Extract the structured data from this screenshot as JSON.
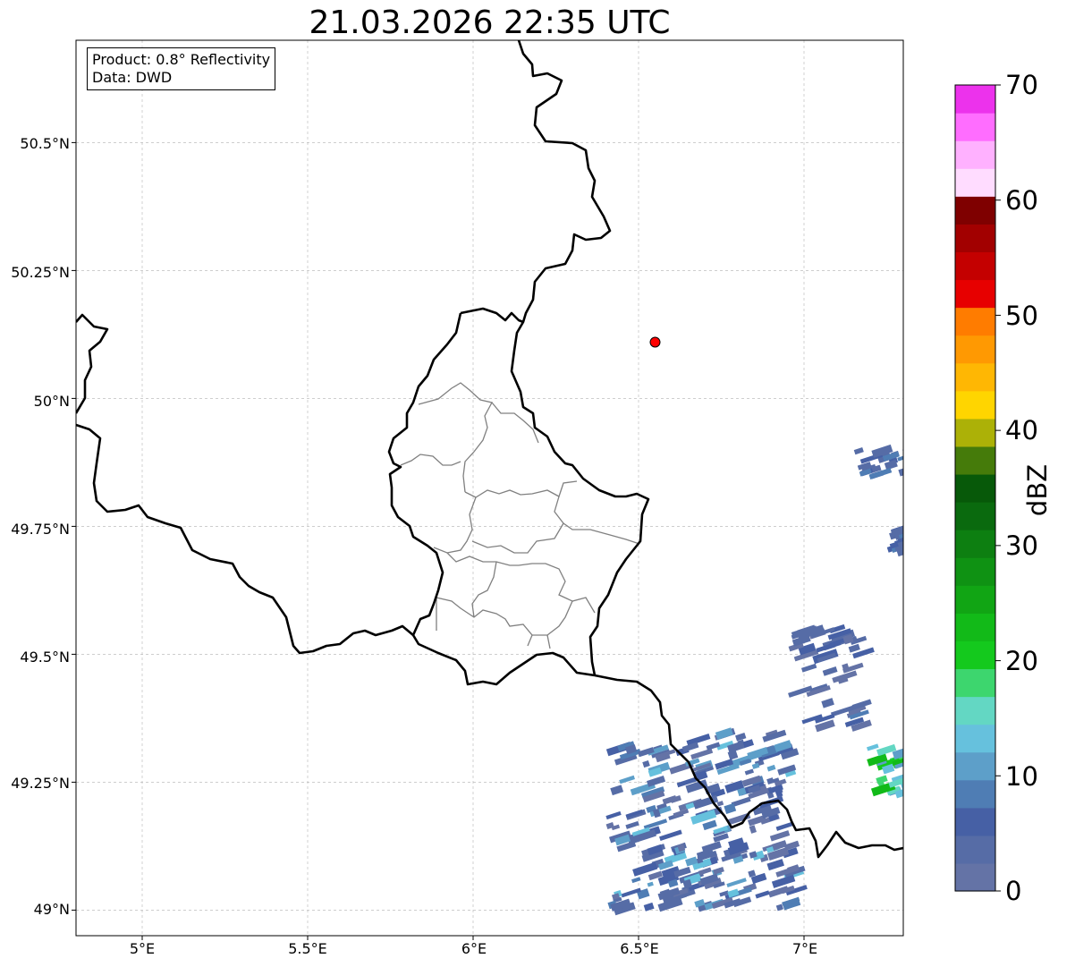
{
  "title": "21.03.2026 22:35 UTC",
  "info": {
    "product": "Product: 0.8° Reflectivity",
    "source": "Data: DWD"
  },
  "axes": {
    "lon_ticks": [
      "5°E",
      "5.5°E",
      "6°E",
      "6.5°E",
      "7°E"
    ],
    "lon_values": [
      5.0,
      5.5,
      6.0,
      6.5,
      7.0
    ],
    "lat_ticks": [
      "50.5°N",
      "50.25°N",
      "50°N",
      "49.75°N",
      "49.5°N",
      "49.25°N",
      "49°N"
    ],
    "lat_values": [
      50.5,
      50.25,
      50.0,
      49.75,
      49.5,
      49.25,
      49.0
    ],
    "lon_range": [
      4.8,
      7.3
    ],
    "lat_range": [
      48.95,
      50.7
    ],
    "grid": true
  },
  "radar_site": {
    "lon": 6.55,
    "lat": 50.11,
    "color": "#ff0000"
  },
  "colorbar": {
    "unit": "dBZ",
    "ticks": [
      "0",
      "10",
      "20",
      "30",
      "40",
      "50",
      "60",
      "70"
    ],
    "tick_values": [
      0,
      10,
      20,
      30,
      40,
      50,
      60,
      70
    ],
    "range": [
      0,
      70
    ],
    "colors": [
      "#6473a6",
      "#566ca6",
      "#4660a5",
      "#4f7db4",
      "#5d9fc9",
      "#66c1dd",
      "#63d7c3",
      "#3dd66e",
      "#14c91d",
      "#12ba18",
      "#11a514",
      "#0f9213",
      "#0d7f11",
      "#0a6a0e",
      "#075909",
      "#457b0a",
      "#acb107",
      "#ffd500",
      "#ffb703",
      "#ff9902",
      "#ff7c00",
      "#e70000",
      "#c40000",
      "#a20000",
      "#7f0000",
      "#ffdcff",
      "#ffb1ff",
      "#ff6dff",
      "#ec32ec"
    ]
  },
  "chart_data": {
    "type": "heatmap",
    "title": "21.03.2026 22:35 UTC",
    "xlabel": "",
    "ylabel": "",
    "xlim": [
      4.8,
      7.3
    ],
    "ylim": [
      48.95,
      50.7
    ],
    "value_unit": "dBZ",
    "echo_regions": [
      {
        "lon": [
          6.4,
          6.95
        ],
        "lat": [
          49.0,
          49.35
        ],
        "dbz": [
          2,
          14
        ]
      },
      {
        "lon": [
          6.95,
          7.15
        ],
        "lat": [
          49.35,
          49.55
        ],
        "dbz": [
          2,
          8
        ]
      },
      {
        "lon": [
          7.15,
          7.3
        ],
        "lat": [
          49.22,
          49.32
        ],
        "dbz": [
          10,
          30
        ]
      },
      {
        "lon": [
          7.15,
          7.3
        ],
        "lat": [
          49.85,
          49.9
        ],
        "dbz": [
          4,
          10
        ]
      },
      {
        "lon": [
          7.25,
          7.3
        ],
        "lat": [
          49.7,
          49.75
        ],
        "dbz": [
          4,
          8
        ]
      }
    ]
  }
}
